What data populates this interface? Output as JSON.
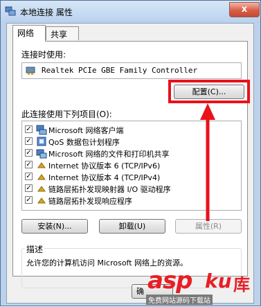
{
  "window": {
    "title": "本地连接 属性",
    "close_glyph": "x"
  },
  "tabs": [
    {
      "label": "网络",
      "active": true
    },
    {
      "label": "共享",
      "active": false
    }
  ],
  "connect_using": {
    "label": "连接时使用:",
    "adapter": "Realtek PCIe GBE Family Controller"
  },
  "configure_button": "配置(C)...",
  "items_label": "此连接使用下列项目(O):",
  "items": [
    {
      "label": "Microsoft 网络客户端",
      "checked": true,
      "icon": "network-client-icon"
    },
    {
      "label": "QoS 数据包计划程序",
      "checked": true,
      "icon": "qos-icon"
    },
    {
      "label": "Microsoft 网络的文件和打印机共享",
      "checked": true,
      "icon": "file-printer-sharing-icon"
    },
    {
      "label": "Internet 协议版本 6 (TCP/IPv6)",
      "checked": true,
      "icon": "protocol-icon"
    },
    {
      "label": "Internet 协议版本 4 (TCP/IPv4)",
      "checked": true,
      "icon": "protocol-icon"
    },
    {
      "label": "链路层拓扑发现映射器 I/O 驱动程序",
      "checked": true,
      "icon": "protocol-icon"
    },
    {
      "label": "链路层拓扑发现响应程序",
      "checked": true,
      "icon": "protocol-icon"
    }
  ],
  "buttons": {
    "install": "安装(N)...",
    "uninstall": "卸载(U)",
    "properties": "属性(R)"
  },
  "description": {
    "title": "描述",
    "text": "允许您的计算机访问 Microsoft 网络上的资源。"
  },
  "bottom_button_partial": "确",
  "annotation_color": "#e8121b",
  "watermark": {
    "brand": "asp",
    "brand_suffix": "ku",
    "brand_glyph": "库",
    "sub": "免费网站源码下载站"
  }
}
